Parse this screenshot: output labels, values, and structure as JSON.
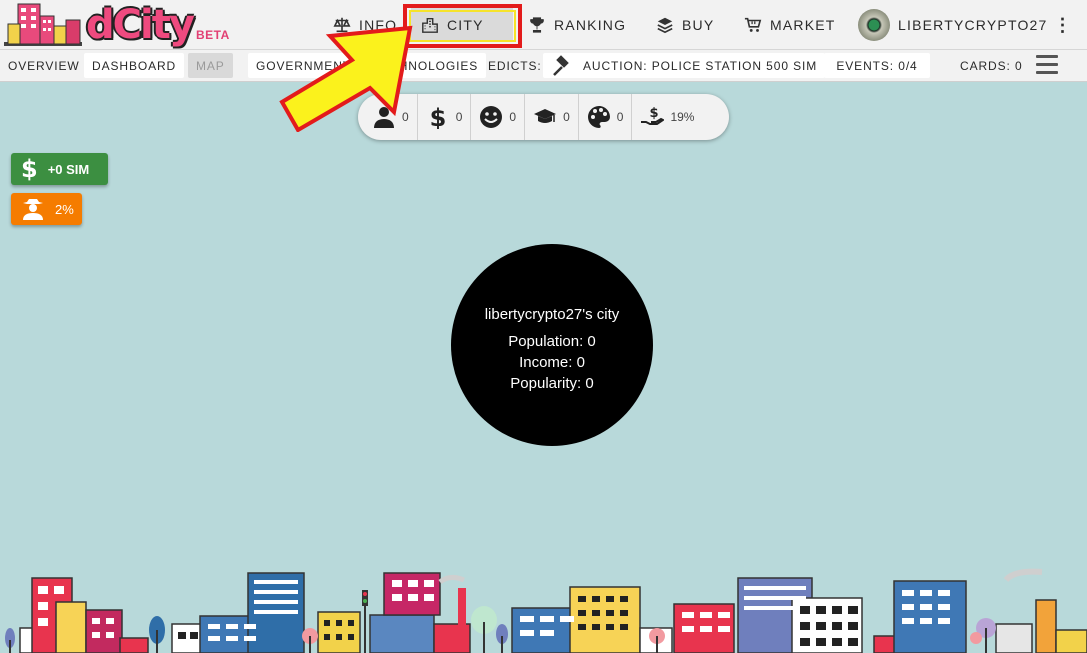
{
  "app": {
    "logo_text": "dCity",
    "logo_badge": "BETA"
  },
  "nav": [
    {
      "label": "INFO",
      "icon": "balance-scale-icon"
    },
    {
      "label": "CITY",
      "icon": "city-icon",
      "active": true
    },
    {
      "label": "RANKING",
      "icon": "trophy-icon"
    },
    {
      "label": "BUY",
      "icon": "layers-icon"
    },
    {
      "label": "MARKET",
      "icon": "cart-icon"
    }
  ],
  "user": {
    "name": "LIBERTYCRYPTO27",
    "menu_icon": "more-vert-icon"
  },
  "subnav": {
    "overview": "OVERVIEW",
    "dashboard": "DASHBOARD",
    "map": "MAP",
    "government": "GOVERNMENT",
    "technologies": "TECHNOLOGIES",
    "edicts": "EDICTS:",
    "auction": "AUCTION: POLICE STATION 500 SIM",
    "events": "EVENTS: 0/4",
    "cards": "CARDS: 0"
  },
  "stats": {
    "population": "0",
    "income": "0",
    "happiness": "0",
    "education": "0",
    "culture": "0",
    "tax": "19%"
  },
  "badges": {
    "money": "+0 SIM",
    "crime": "2%"
  },
  "city": {
    "title": "libertycrypto27's city",
    "population": "Population: 0",
    "income": "Income: 0",
    "popularity": "Popularity: 0"
  },
  "colors": {
    "background": "#b8d9da",
    "highlight_red": "#e31b1b",
    "arrow_yellow": "#fbf21c",
    "money_green": "#3c8f41",
    "crime_orange": "#f57c00"
  }
}
